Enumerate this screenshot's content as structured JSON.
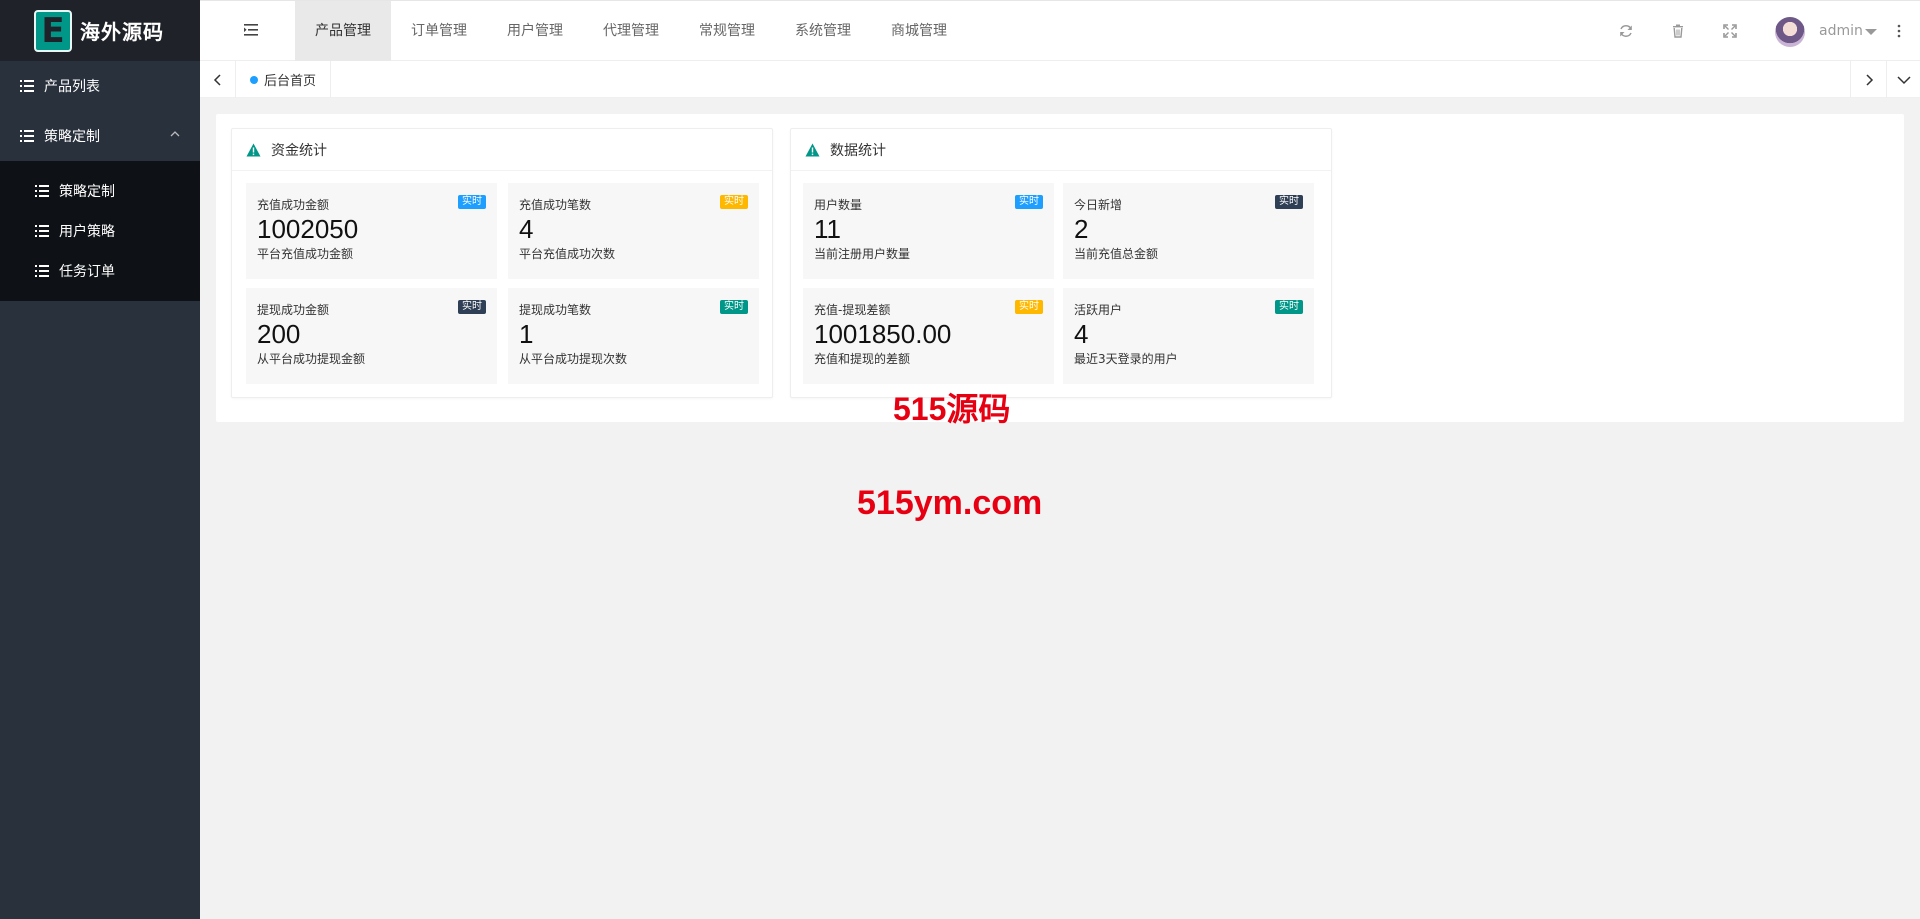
{
  "brand": {
    "logo_letter": "E",
    "name": "海外源码"
  },
  "sidebar": {
    "items": [
      {
        "label": "产品列表"
      },
      {
        "label": "策略定制"
      }
    ],
    "subitems": [
      {
        "label": "策略定制"
      },
      {
        "label": "用户策略"
      },
      {
        "label": "任务订单"
      }
    ]
  },
  "topnav": {
    "items": [
      {
        "label": "产品管理"
      },
      {
        "label": "订单管理"
      },
      {
        "label": "用户管理"
      },
      {
        "label": "代理管理"
      },
      {
        "label": "常规管理"
      },
      {
        "label": "系统管理"
      },
      {
        "label": "商城管理"
      }
    ],
    "active_index": 0
  },
  "header": {
    "user_name": "admin"
  },
  "tabs": {
    "home_label": "后台首页"
  },
  "panels": [
    {
      "title": "资金统计",
      "stats": [
        {
          "title": "充值成功金额",
          "value": "1002050",
          "desc": "平台充值成功金额",
          "badge": "实时",
          "badge_color": "#1e9fff"
        },
        {
          "title": "充值成功笔数",
          "value": "4",
          "desc": "平台充值成功次数",
          "badge": "实时",
          "badge_color": "#ffb800"
        },
        {
          "title": "提现成功金额",
          "value": "200",
          "desc": "从平台成功提现金额",
          "badge": "实时",
          "badge_color": "#2f4056"
        },
        {
          "title": "提现成功笔数",
          "value": "1",
          "desc": "从平台成功提现次数",
          "badge": "实时",
          "badge_color": "#009688"
        }
      ]
    },
    {
      "title": "数据统计",
      "stats": [
        {
          "title": "用户数量",
          "value": "11",
          "desc": "当前注册用户数量",
          "badge": "实时",
          "badge_color": "#1e9fff"
        },
        {
          "title": "今日新增",
          "value": "2",
          "desc": "当前充值总金额",
          "badge": "实时",
          "badge_color": "#2f4056"
        },
        {
          "title": "充值-提现差额",
          "value": "1001850.00",
          "desc": "充值和提现的差额",
          "badge": "实时",
          "badge_color": "#ffb800"
        },
        {
          "title": "活跃用户",
          "value": "4",
          "desc": "最近3天登录的用户",
          "badge": "实时",
          "badge_color": "#009688"
        }
      ]
    }
  ],
  "watermarks": {
    "line1": "515源码",
    "line2": "515ym.com"
  },
  "colors": {
    "accent": "#009688",
    "sidebar_bg": "#28313c",
    "logo_bg": "#20222a",
    "subnav_bg": "#0e1116",
    "watermark": "#e60012"
  }
}
